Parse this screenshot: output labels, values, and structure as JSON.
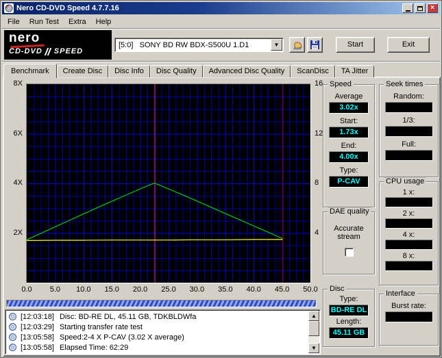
{
  "window": {
    "title": "Nero CD-DVD Speed 4.7.7.16"
  },
  "menu": {
    "items": [
      "File",
      "Run Test",
      "Extra",
      "Help"
    ]
  },
  "toolbar": {
    "logo": {
      "line1": "nero",
      "line2a": "CD-DVD",
      "line2b": "SPEED"
    },
    "drive_select": {
      "value": "[5:0]   SONY BD RW BDX-S500U 1.D1"
    },
    "start_label": "Start",
    "exit_label": "Exit"
  },
  "tabs": {
    "active": "Benchmark",
    "items": [
      "Benchmark",
      "Create Disc",
      "Disc Info",
      "Disc Quality",
      "Advanced Disc Quality",
      "ScanDisc",
      "TA Jitter"
    ]
  },
  "chart_data": {
    "type": "line",
    "x_range": [
      0,
      50
    ],
    "x_ticks": [
      "0.0",
      "5.0",
      "10.0",
      "15.0",
      "20.0",
      "25.0",
      "30.0",
      "35.0",
      "40.0",
      "45.0",
      "50.0"
    ],
    "x_tick_values": [
      0,
      5,
      10,
      15,
      20,
      25,
      30,
      35,
      40,
      45,
      50
    ],
    "x_minor_step": 1.25,
    "x_major_step": 5,
    "y_left": {
      "range": [
        0,
        8
      ],
      "ticks": [
        "8X",
        "6X",
        "4X",
        "2X"
      ],
      "tick_values": [
        8,
        6,
        4,
        2
      ]
    },
    "y_right": {
      "range": [
        0,
        16
      ],
      "ticks": [
        "16",
        "12",
        "8",
        "4"
      ],
      "tick_values": [
        16,
        12,
        8,
        4
      ]
    },
    "y_minor_step": 0.5,
    "y_major_step": 2,
    "background": "#000000",
    "grid_color": "#0000a0",
    "grid_major_color": "#0000dc",
    "series": [
      {
        "name": "read-speed",
        "color": "#00d200",
        "points": [
          [
            0,
            1.73
          ],
          [
            2.5,
            1.99
          ],
          [
            5,
            2.25
          ],
          [
            7.5,
            2.51
          ],
          [
            10,
            2.77
          ],
          [
            12.5,
            3.03
          ],
          [
            15,
            3.28
          ],
          [
            17.5,
            3.53
          ],
          [
            20,
            3.78
          ],
          [
            22.5,
            4.02
          ],
          [
            25,
            3.78
          ],
          [
            27.5,
            3.54
          ],
          [
            30,
            3.29
          ],
          [
            32.5,
            3.04
          ],
          [
            35,
            2.79
          ],
          [
            37.5,
            2.54
          ],
          [
            40,
            2.29
          ],
          [
            42.5,
            2.04
          ],
          [
            45.1,
            1.78
          ]
        ]
      },
      {
        "name": "rotation-speed",
        "color": "#ffff00",
        "points": [
          [
            0,
            1.7
          ],
          [
            5,
            1.71
          ],
          [
            10,
            1.71
          ],
          [
            15,
            1.72
          ],
          [
            20,
            1.72
          ],
          [
            25,
            1.72
          ],
          [
            30,
            1.73
          ],
          [
            35,
            1.73
          ],
          [
            40,
            1.74
          ],
          [
            45.1,
            1.74
          ]
        ]
      }
    ],
    "vertical_markers": [
      {
        "name": "layer-break",
        "color": "#ff00ff",
        "x": 22.5
      },
      {
        "name": "capacity-end",
        "color": "#900000",
        "x": 45.1
      }
    ]
  },
  "panels": {
    "speed": {
      "title": "Speed",
      "rows": [
        {
          "key": "average",
          "label": "Average",
          "value": "3.02x"
        },
        {
          "key": "start",
          "label": "Start:",
          "value": "1.73x"
        },
        {
          "key": "end",
          "label": "End:",
          "value": "4.00x"
        },
        {
          "key": "type",
          "label": "Type:",
          "value": "P-CAV"
        }
      ]
    },
    "seek": {
      "title": "Seek times",
      "rows": [
        {
          "key": "random",
          "label": "Random:",
          "value": ""
        },
        {
          "key": "one-third",
          "label": "1/3:",
          "value": ""
        },
        {
          "key": "full",
          "label": "Full:",
          "value": ""
        }
      ]
    },
    "cpu": {
      "title": "CPU usage",
      "rows": [
        {
          "key": "1x",
          "label": "1 x:",
          "value": ""
        },
        {
          "key": "2x",
          "label": "2 x:",
          "value": ""
        },
        {
          "key": "4x",
          "label": "4 x:",
          "value": ""
        },
        {
          "key": "8x",
          "label": "8 x:",
          "value": ""
        }
      ]
    },
    "dae": {
      "title": "DAE quality",
      "label": "Accurate stream",
      "checked": false
    },
    "disc": {
      "title": "Disc",
      "rows": [
        {
          "key": "type",
          "label": "Type:",
          "value": "BD-RE DL"
        },
        {
          "key": "length",
          "label": "Length:",
          "value": "45.11 GB"
        }
      ]
    },
    "interface": {
      "title": "Interface",
      "label": "Burst rate:",
      "value": ""
    }
  },
  "log": {
    "lines": [
      {
        "time": "[12:03:18]",
        "text": "Disc: BD-RE DL, 45.11 GB, TDKBLDWfa"
      },
      {
        "time": "[12:03:29]",
        "text": "Starting transfer rate test"
      },
      {
        "time": "[13:05:58]",
        "text": "Speed:2-4 X P-CAV (3.02 X average)"
      },
      {
        "time": "[13:05:58]",
        "text": "Elapsed Time: 62:29"
      }
    ]
  }
}
